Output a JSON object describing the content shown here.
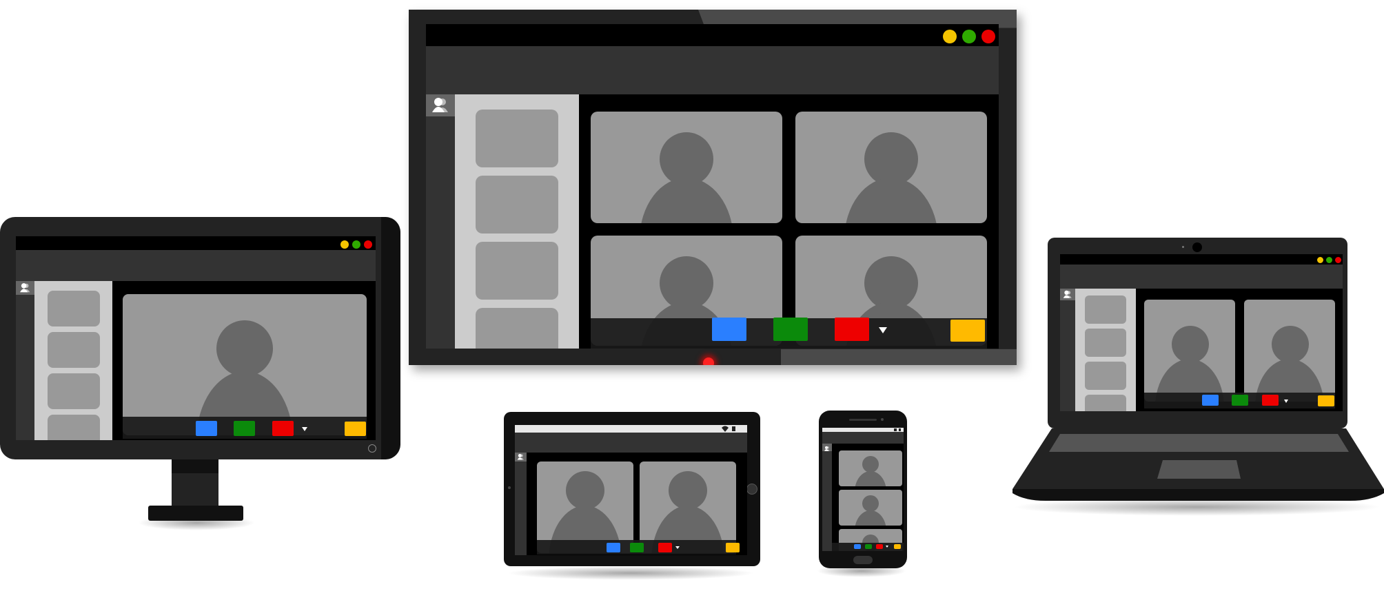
{
  "colors": {
    "close": "#ea0000",
    "minimize": "#f5c400",
    "maximize": "#2faa00",
    "blue_button": "#2a7fff",
    "green_button": "#0b8a0b",
    "red_button": "#ee0000",
    "yellow_button": "#ffba00",
    "tile": "#999999",
    "person": "#686868",
    "sidebar": "#cccccc"
  },
  "icons": {
    "participants": "people-icon",
    "dropdown": "caret-down-icon",
    "wifi": "wifi-icon",
    "battery": "battery-icon",
    "power": "power-icon",
    "camera": "webcam-icon"
  },
  "devices": [
    "tv",
    "desktop-monitor",
    "laptop",
    "tablet",
    "phone"
  ]
}
